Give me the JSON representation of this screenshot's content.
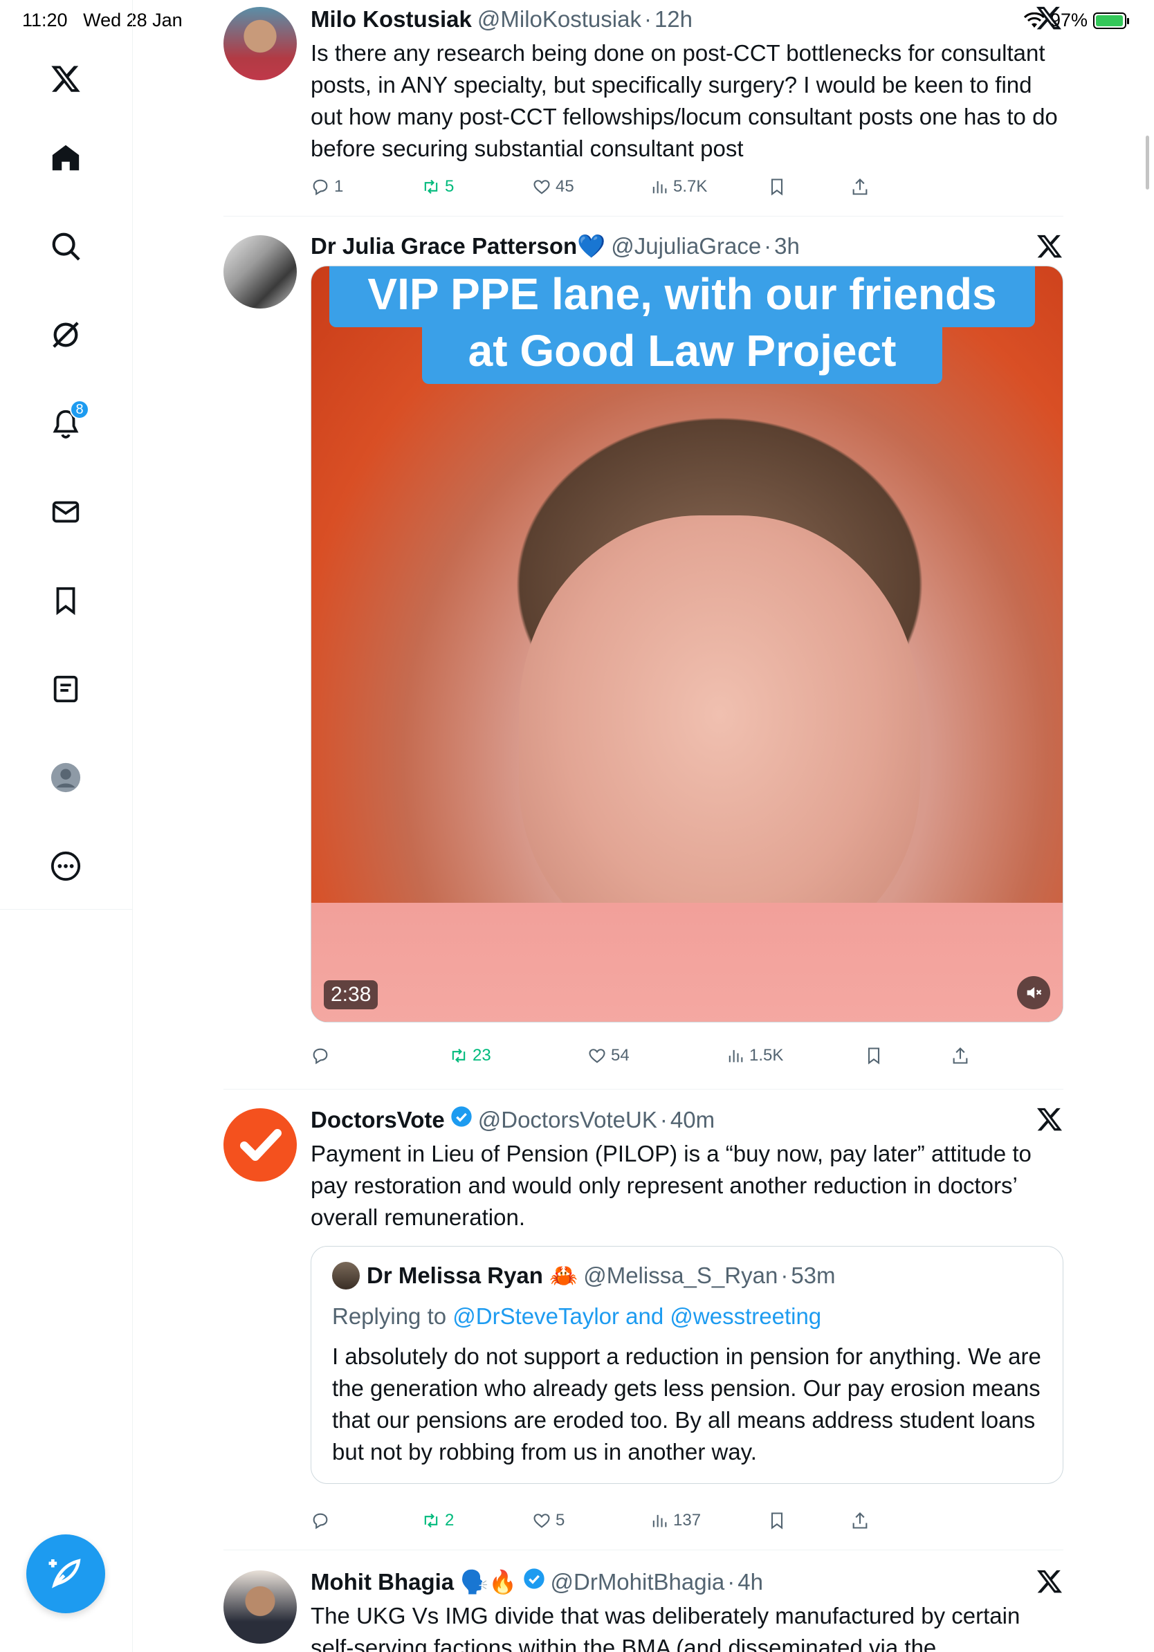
{
  "status_bar": {
    "time": "11:20",
    "date": "Wed 28 Jan",
    "battery": "97%",
    "battery_level": 0.97
  },
  "sidebar": {
    "items": [
      {
        "name": "x-logo"
      },
      {
        "name": "home"
      },
      {
        "name": "search"
      },
      {
        "name": "grok"
      },
      {
        "name": "notifications",
        "badge": "8"
      },
      {
        "name": "messages"
      },
      {
        "name": "bookmarks"
      },
      {
        "name": "lists"
      },
      {
        "name": "profile"
      },
      {
        "name": "more"
      }
    ]
  },
  "tweets": [
    {
      "name": "Milo Kostusiak",
      "handle": "@MiloKostusiak",
      "time": "12h",
      "text": "Is there any research being done on post-CCT bottlenecks for consultant posts, in ANY specialty, but specifically surgery? I would be keen to find out how many post-CCT fellowships/locum consultant posts one has to do before securing substantial consultant post",
      "replies": "1",
      "retweets": "5",
      "likes": "45",
      "views": "5.7K"
    },
    {
      "name": "Dr Julia Grace Patterson💙",
      "handle": "@JujuliaGrace",
      "time": "3h",
      "media_caption_1": "VIP PPE lane, with our friends",
      "media_caption_2": "at Good Law Project",
      "duration": "2:38",
      "replies": "",
      "retweets": "23",
      "likes": "54",
      "views": "1.5K"
    },
    {
      "name": "DoctorsVote",
      "handle": "@DoctorsVoteUK",
      "time": "40m",
      "text": "Payment in Lieu of Pension (PILOP) is a “buy now, pay later” attitude to pay restoration and would only represent another reduction in doctors’ overall remuneration.",
      "quote": {
        "name": "Dr Melissa Ryan 🦀",
        "handle": "@Melissa_S_Ryan",
        "time": "53m",
        "replying_prefix": "Replying to",
        "replying_to": "@DrSteveTaylor and @wesstreeting",
        "text": "I absolutely do not support a reduction in pension for anything. We are the generation who already gets less pension. Our pay erosion means that our pensions are eroded too. By all means address student loans but not by robbing from us in another way."
      },
      "replies": "",
      "retweets": "2",
      "likes": "5",
      "views": "137"
    },
    {
      "name": "Mohit Bhagia 🗣️🔥",
      "handle": "@DrMohitBhagia",
      "time": "4h",
      "text": "The UKG Vs IMG divide that was deliberately manufactured by certain self-serving factions within the BMA (and disseminated via the"
    }
  ],
  "colors": {
    "accent": "#1d9bf0",
    "retweet": "#00ba7c",
    "muted": "#536471",
    "orange": "#f4511e"
  }
}
